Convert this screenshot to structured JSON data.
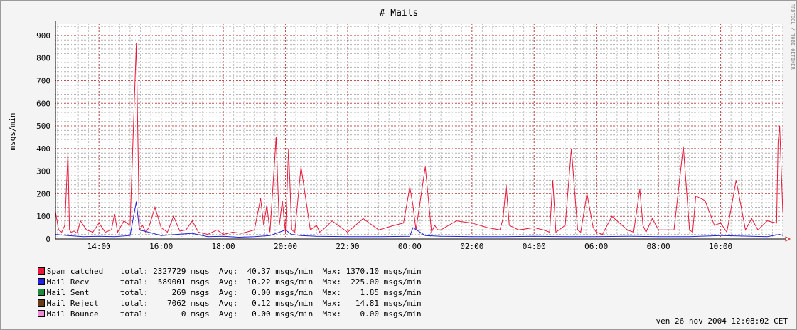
{
  "chart_data": {
    "type": "line",
    "title": "# Mails",
    "ylabel": "msgs/min",
    "watermark": "RRDTOOL / TOBI OETIKER",
    "ylim": [
      0,
      950
    ],
    "yticks": [
      0,
      100,
      200,
      300,
      400,
      500,
      600,
      700,
      800,
      900
    ],
    "xlim_hours": [
      12.6,
      36.0
    ],
    "xtick_labels": [
      "14:00",
      "16:00",
      "18:00",
      "20:00",
      "22:00",
      "00:00",
      "02:00",
      "04:00",
      "06:00",
      "08:00",
      "10:00"
    ],
    "grid": true,
    "legend_position": "bottom-left",
    "series": [
      {
        "name": "Spam catched",
        "color": "#e8183a",
        "stats": {
          "total": "2327729",
          "avg": "40.37",
          "max": "1370.10"
        },
        "x": [
          12.6,
          12.7,
          12.8,
          12.9,
          13.0,
          13.05,
          13.1,
          13.2,
          13.3,
          13.4,
          13.6,
          13.8,
          14.0,
          14.2,
          14.4,
          14.5,
          14.6,
          14.8,
          15.0,
          15.2,
          15.3,
          15.4,
          15.5,
          15.6,
          15.8,
          16.0,
          16.2,
          16.4,
          16.6,
          16.8,
          17.0,
          17.2,
          17.5,
          17.8,
          18.0,
          18.3,
          18.6,
          19.0,
          19.2,
          19.3,
          19.4,
          19.5,
          19.7,
          19.8,
          19.9,
          20.0,
          20.1,
          20.2,
          20.3,
          20.5,
          20.8,
          21.0,
          21.1,
          21.2,
          21.5,
          22.0,
          22.5,
          23.0,
          23.5,
          23.8,
          24.0,
          24.1,
          24.2,
          24.5,
          24.7,
          24.8,
          24.9,
          25.0,
          25.5,
          26.0,
          26.5,
          26.9,
          27.0,
          27.1,
          27.2,
          27.5,
          28.0,
          28.3,
          28.5,
          28.6,
          28.7,
          29.0,
          29.2,
          29.4,
          29.5,
          29.7,
          29.9,
          30.0,
          30.2,
          30.5,
          31.0,
          31.2,
          31.4,
          31.5,
          31.6,
          31.8,
          32.0,
          32.5,
          32.8,
          33.0,
          33.1,
          33.2,
          33.5,
          33.8,
          34.0,
          34.2,
          34.5,
          34.8,
          35.0,
          35.2,
          35.5,
          35.8,
          35.85,
          35.9,
          36.0
        ],
        "y": [
          120,
          40,
          30,
          60,
          380,
          40,
          30,
          35,
          25,
          80,
          40,
          30,
          70,
          30,
          40,
          110,
          30,
          80,
          60,
          865,
          40,
          60,
          30,
          50,
          140,
          50,
          30,
          100,
          35,
          40,
          80,
          30,
          20,
          40,
          20,
          30,
          25,
          40,
          180,
          60,
          150,
          30,
          450,
          60,
          170,
          30,
          400,
          40,
          30,
          320,
          40,
          60,
          30,
          40,
          80,
          30,
          90,
          40,
          60,
          70,
          230,
          150,
          40,
          320,
          30,
          60,
          40,
          40,
          80,
          70,
          50,
          40,
          90,
          240,
          60,
          40,
          50,
          40,
          30,
          260,
          30,
          60,
          400,
          40,
          30,
          200,
          50,
          30,
          20,
          100,
          40,
          30,
          220,
          60,
          30,
          90,
          40,
          40,
          410,
          40,
          30,
          190,
          170,
          60,
          70,
          30,
          260,
          40,
          90,
          40,
          80,
          70,
          430,
          500,
          120
        ]
      },
      {
        "name": "Mail Recv",
        "color": "#2020e0",
        "stats": {
          "total": "589001",
          "avg": "10.22",
          "max": "225.00"
        },
        "x": [
          12.6,
          13.0,
          13.5,
          14.0,
          14.5,
          15.0,
          15.2,
          15.3,
          15.6,
          16.0,
          16.5,
          17.0,
          17.5,
          18.0,
          18.5,
          19.0,
          19.5,
          19.8,
          20.0,
          20.2,
          20.5,
          21.0,
          22.0,
          23.0,
          24.0,
          24.1,
          24.5,
          25.0,
          26.0,
          27.0,
          28.0,
          29.0,
          30.0,
          31.0,
          32.0,
          33.0,
          34.0,
          35.0,
          35.5,
          35.9,
          36.0
        ],
        "y": [
          20,
          15,
          10,
          12,
          10,
          15,
          165,
          40,
          30,
          15,
          20,
          25,
          10,
          12,
          8,
          10,
          15,
          30,
          40,
          20,
          15,
          12,
          10,
          10,
          12,
          50,
          15,
          12,
          10,
          10,
          12,
          10,
          10,
          12,
          10,
          10,
          15,
          12,
          10,
          20,
          15
        ]
      },
      {
        "name": "Mail Sent",
        "color": "#1a8a3a",
        "stats": {
          "total": "269",
          "avg": "0.00",
          "max": "1.85"
        },
        "x": [
          12.6,
          36.0
        ],
        "y": [
          0,
          0
        ]
      },
      {
        "name": "Mail Reject",
        "color": "#6a3a12",
        "stats": {
          "total": "7062",
          "avg": "0.12",
          "max": "14.81"
        },
        "x": [
          12.6,
          36.0
        ],
        "y": [
          0,
          0
        ]
      },
      {
        "name": "Mail Bounce",
        "color": "#f08ad8",
        "stats": {
          "total": "0",
          "avg": "0.00",
          "max": "0.00"
        },
        "x": [
          12.6,
          36.0
        ],
        "y": [
          0,
          0
        ]
      }
    ],
    "legend_labels": {
      "total": "total:",
      "avg": "Avg:",
      "max": "Max:",
      "unit": "msgs",
      "rate": "msgs/min"
    },
    "timestamp": "ven 26 nov 2004 12:08:02 CET"
  }
}
